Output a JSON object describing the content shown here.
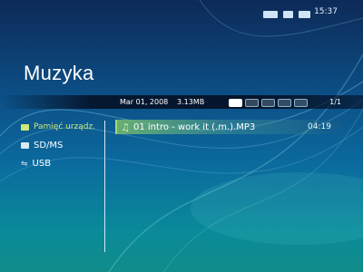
{
  "status": {
    "time": "15:37",
    "icons": [
      "connection-icon",
      "card-icon",
      "battery-icon"
    ]
  },
  "title": "Muzyka",
  "info": {
    "date": "Mar 01, 2008",
    "size": "3.13MB",
    "page": "1/1",
    "codec_icons": [
      "play-mode-icon",
      "shuffle-icon",
      "repeat-icon",
      "eq-icon",
      "bookmark-icon"
    ]
  },
  "sidebar": {
    "items": [
      {
        "label": "Pamięć urządz.",
        "icon": "memory-icon",
        "selected": true
      },
      {
        "label": "SD/MS",
        "icon": "card-icon",
        "selected": false
      },
      {
        "label": "USB",
        "icon": "usb-icon",
        "selected": false
      }
    ]
  },
  "tracks": [
    {
      "name": "01 intro - work it (.m.).MP3",
      "duration": "04:19",
      "icon": "music-note-icon",
      "selected": true
    }
  ],
  "colors": {
    "accent_selected": "#cde87a",
    "highlight": "#78be6e"
  }
}
